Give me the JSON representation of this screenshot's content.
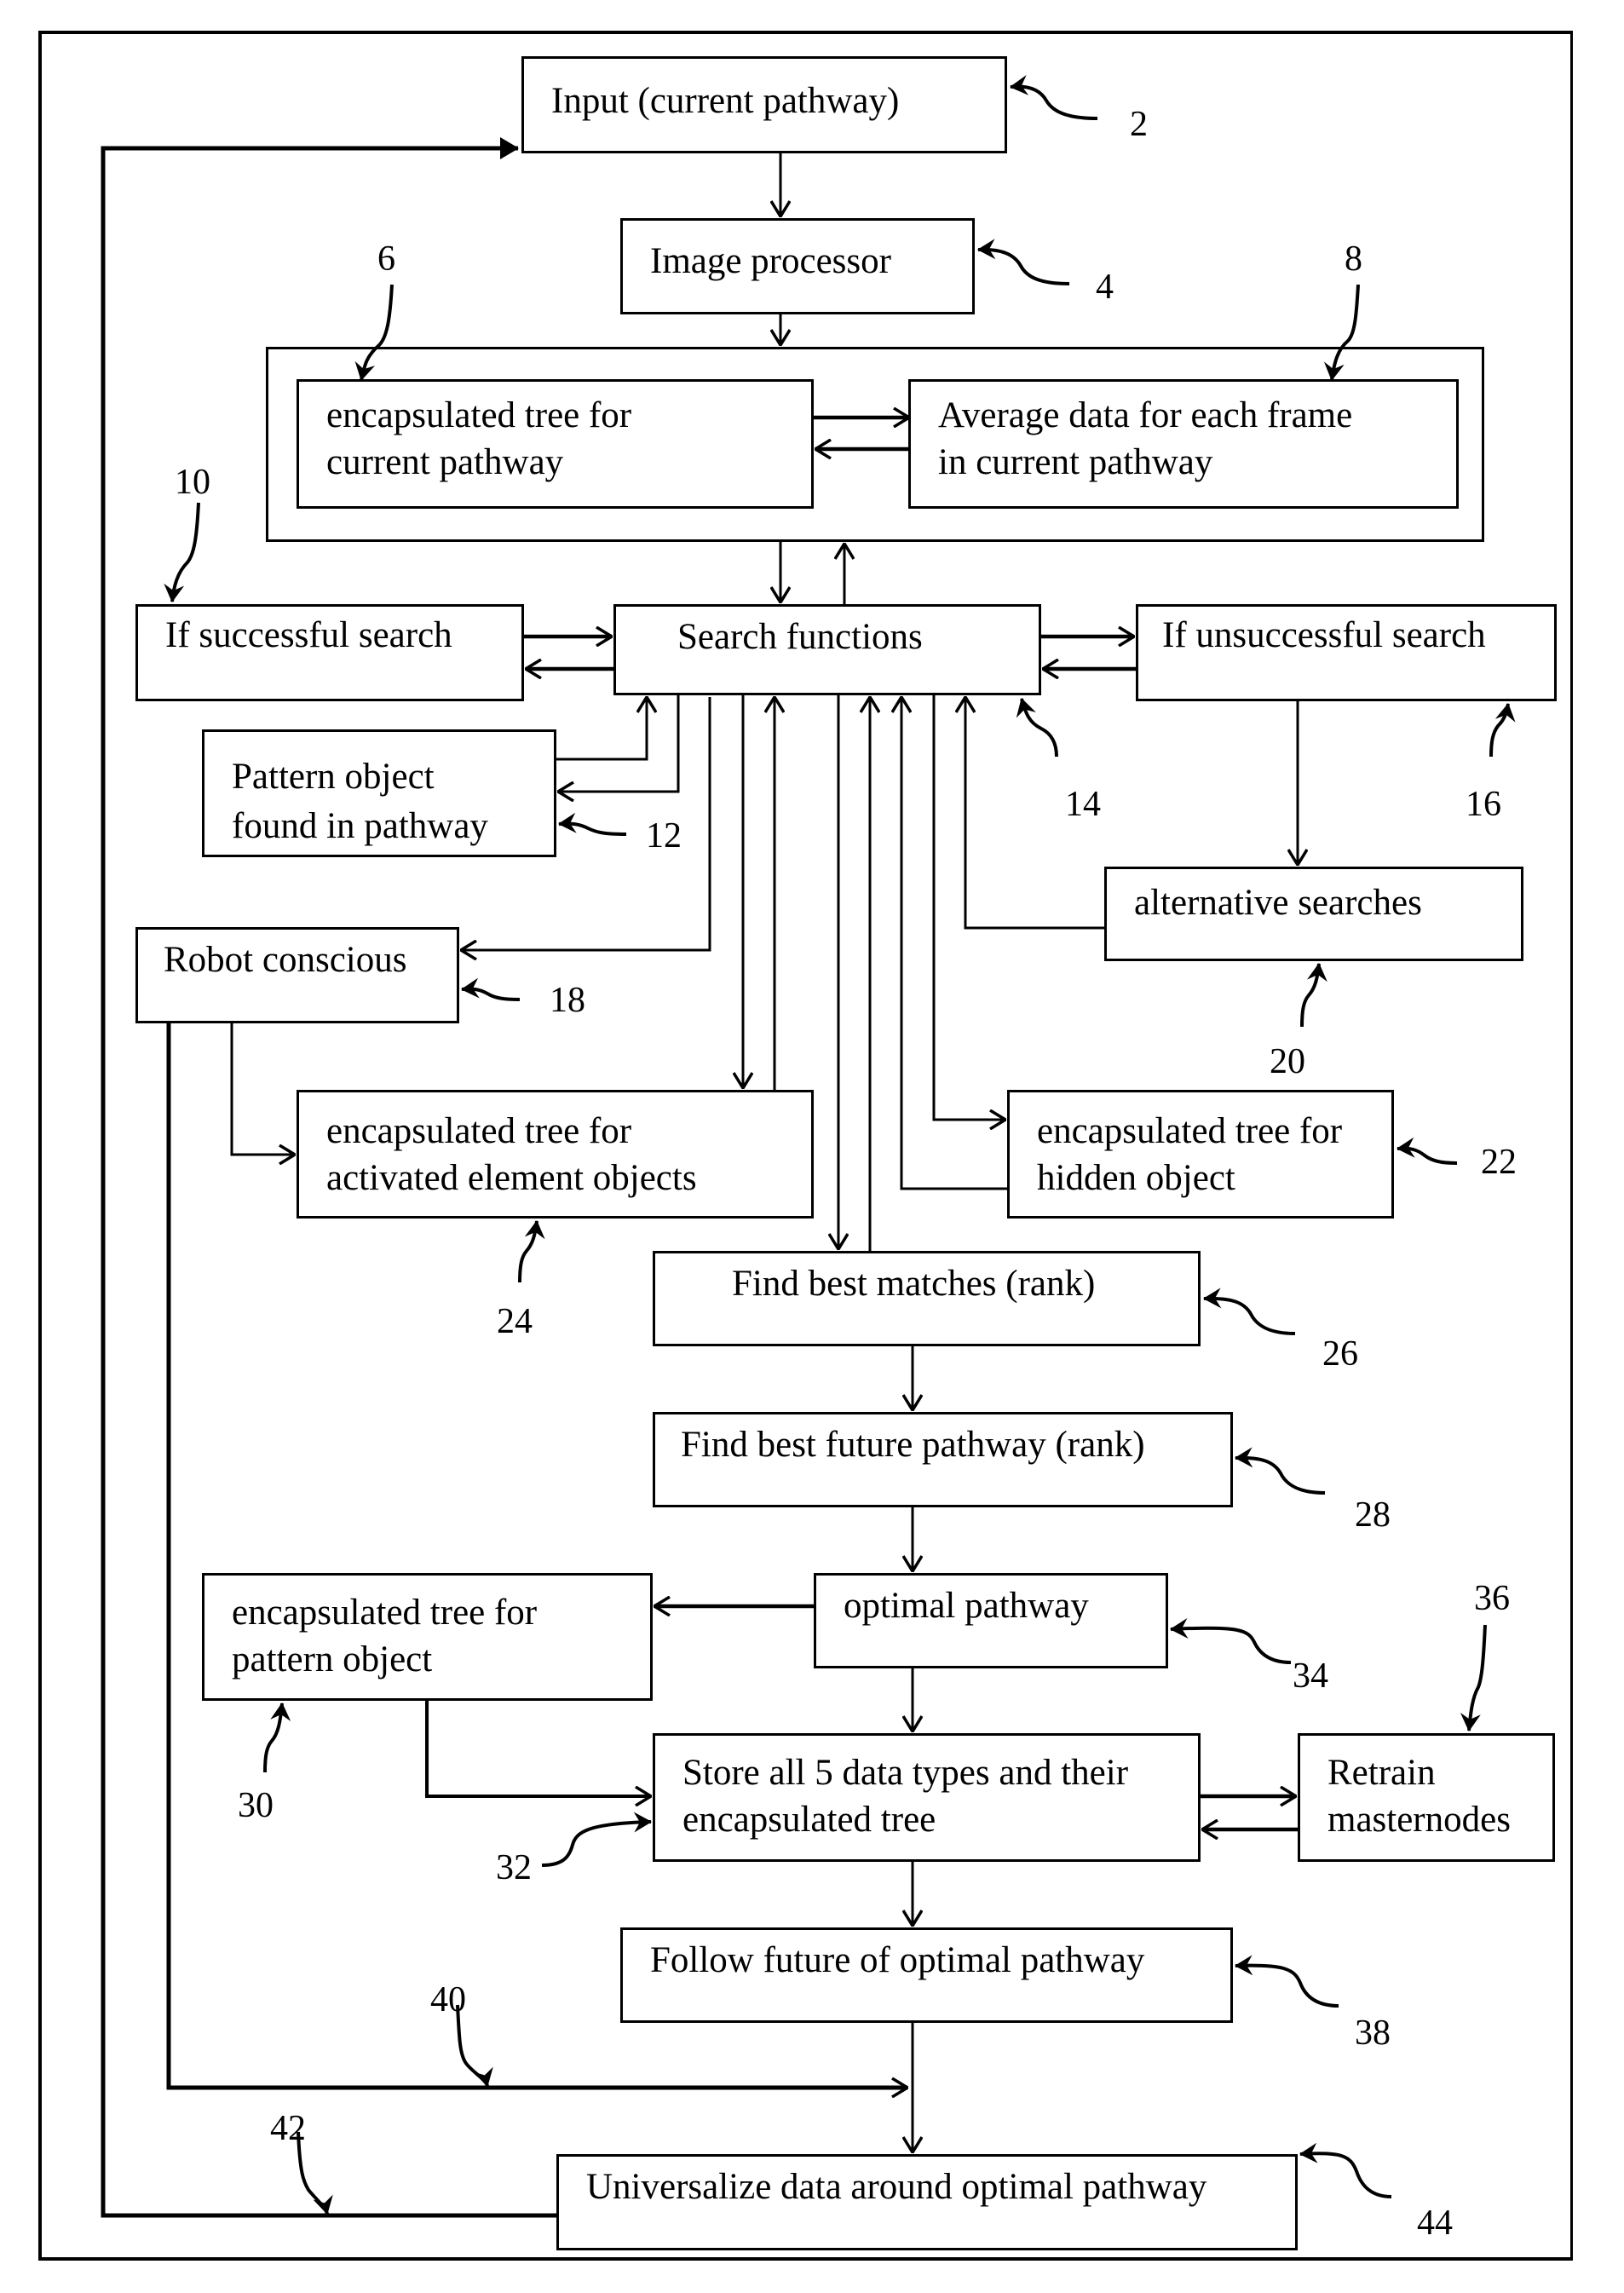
{
  "diagram": {
    "type": "flowchart",
    "boxes": {
      "input": {
        "label": "Input (current pathway)",
        "ref": "2"
      },
      "image_processor": {
        "label": "Image processor",
        "ref": "4"
      },
      "tree_current": {
        "label": "encapsulated tree for\ncurrent pathway",
        "ref": "6"
      },
      "average_data": {
        "label": "Average data for each frame\nin current pathway",
        "ref": "8"
      },
      "successful": {
        "label": "If successful search",
        "ref": "10"
      },
      "pattern_found": {
        "label": "Pattern object\nfound in pathway",
        "ref": "12"
      },
      "search_functions": {
        "label": "Search functions",
        "ref": "14"
      },
      "unsuccessful": {
        "label": "If unsuccessful search",
        "ref": "16"
      },
      "robot_conscious": {
        "label": "Robot conscious",
        "ref": "18"
      },
      "alternative_searches": {
        "label": "alternative searches",
        "ref": "20"
      },
      "tree_hidden": {
        "label": "encapsulated tree for\nhidden object",
        "ref": "22"
      },
      "tree_activated": {
        "label": "encapsulated tree for\nactivated element objects",
        "ref": "24"
      },
      "best_matches": {
        "label": "Find best matches (rank)",
        "ref": "26"
      },
      "best_future": {
        "label": "Find best future pathway (rank)",
        "ref": "28"
      },
      "tree_pattern": {
        "label": "encapsulated tree for\npattern object",
        "ref": "30"
      },
      "store": {
        "label": "Store all 5 data types and their\nencapsulated tree",
        "ref": "32"
      },
      "optimal": {
        "label": "optimal pathway",
        "ref": "34"
      },
      "retrain": {
        "label": "Retrain\nmasternodes",
        "ref": "36"
      },
      "follow": {
        "label": "Follow future of optimal pathway",
        "ref": "38"
      },
      "universalize": {
        "label": "Universalize data around optimal pathway",
        "ref": "44"
      }
    },
    "line_refs": {
      "robot_to_universalize": "40",
      "feedback_loop": "42"
    },
    "edges": [
      [
        "input",
        "image_processor"
      ],
      [
        "image_processor",
        "group_current_pathway"
      ],
      [
        "tree_current",
        "average_data"
      ],
      [
        "average_data",
        "tree_current"
      ],
      [
        "group_current_pathway",
        "search_functions"
      ],
      [
        "search_functions",
        "group_current_pathway"
      ],
      [
        "successful",
        "search_functions"
      ],
      [
        "search_functions",
        "successful"
      ],
      [
        "search_functions",
        "unsuccessful"
      ],
      [
        "unsuccessful",
        "search_functions"
      ],
      [
        "pattern_found",
        "search_functions"
      ],
      [
        "search_functions",
        "pattern_found"
      ],
      [
        "search_functions",
        "robot_conscious"
      ],
      [
        "search_functions",
        "tree_activated"
      ],
      [
        "tree_activated",
        "search_functions"
      ],
      [
        "search_functions",
        "best_matches"
      ],
      [
        "best_matches",
        "search_functions"
      ],
      [
        "tree_hidden",
        "search_functions"
      ],
      [
        "search_functions",
        "tree_hidden"
      ],
      [
        "alternative_searches",
        "search_functions"
      ],
      [
        "unsuccessful",
        "alternative_searches"
      ],
      [
        "robot_conscious",
        "tree_activated"
      ],
      [
        "best_matches",
        "best_future"
      ],
      [
        "best_future",
        "optimal"
      ],
      [
        "optimal",
        "tree_pattern"
      ],
      [
        "optimal",
        "store"
      ],
      [
        "tree_pattern",
        "store"
      ],
      [
        "store",
        "retrain"
      ],
      [
        "retrain",
        "store"
      ],
      [
        "store",
        "follow"
      ],
      [
        "follow",
        "universalize"
      ],
      [
        "robot_conscious",
        "universalize"
      ],
      [
        "universalize",
        "input"
      ]
    ]
  }
}
